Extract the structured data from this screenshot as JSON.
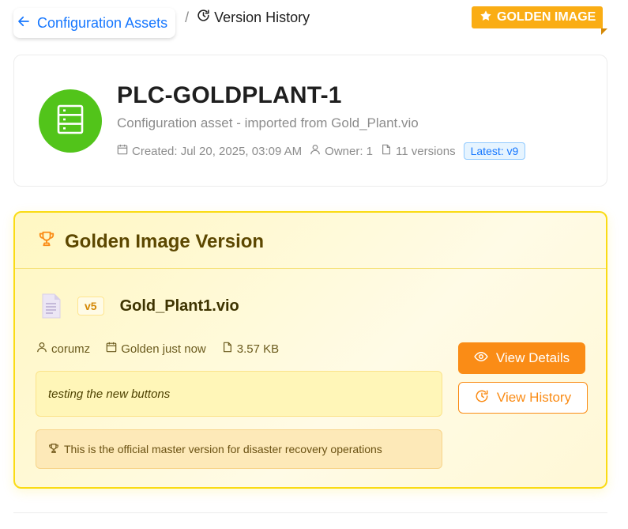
{
  "breadcrumb": {
    "back_label": "Configuration Assets",
    "separator": "/",
    "current": "Version History"
  },
  "asset": {
    "title": "PLC-GOLDPLANT-1",
    "description": "Configuration asset - imported from Gold_Plant.vio",
    "created": "Created: Jul 20, 2025, 03:09 AM",
    "owner": "Owner: 1",
    "versions": "11 versions",
    "latest": "Latest: v9",
    "avatar_color": "#52c41a",
    "icon": "database-icon"
  },
  "golden": {
    "header_title": "Golden Image Version",
    "ribbon_label": "GOLDEN IMAGE",
    "version_tag": "v5",
    "file_name": "Gold_Plant1.vio",
    "user": "corumz",
    "status": "Golden just now",
    "size": "3.57 KB",
    "comment": "testing the new buttons",
    "master_note": "This is the official master version for disaster recovery operations",
    "view_details_label": "View Details",
    "view_history_label": "View History",
    "accent_color": "#fa8c16",
    "border_color": "#fadb14"
  }
}
